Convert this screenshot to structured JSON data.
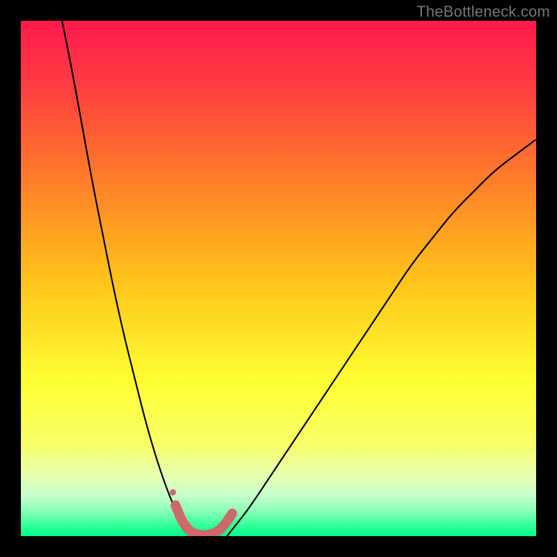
{
  "watermark": "TheBottleneck.com",
  "chart_data": {
    "type": "line",
    "title": "",
    "xlabel": "",
    "ylabel": "",
    "xlim": [
      0,
      100
    ],
    "ylim": [
      0,
      100
    ],
    "grid": false,
    "legend": false,
    "gradient_stops": [
      {
        "offset": 0.0,
        "color": "#ff1a4d"
      },
      {
        "offset": 0.12,
        "color": "#ff3b42"
      },
      {
        "offset": 0.3,
        "color": "#ff7a2a"
      },
      {
        "offset": 0.5,
        "color": "#ffc21a"
      },
      {
        "offset": 0.7,
        "color": "#ffff33"
      },
      {
        "offset": 0.82,
        "color": "#f7ff66"
      },
      {
        "offset": 0.88,
        "color": "#e9ffb0"
      },
      {
        "offset": 0.92,
        "color": "#c8ffcc"
      },
      {
        "offset": 0.95,
        "color": "#8effb8"
      },
      {
        "offset": 0.975,
        "color": "#3eff9e"
      },
      {
        "offset": 1.0,
        "color": "#00ff88"
      }
    ],
    "series": [
      {
        "name": "left-curve",
        "stroke": "#000000",
        "width": 2.2,
        "x": [
          8,
          10,
          12,
          14,
          16,
          18,
          20,
          22,
          24,
          26,
          28,
          30,
          32
        ],
        "y": [
          100,
          90,
          79,
          68,
          58,
          48,
          39,
          31,
          23,
          16,
          10,
          5,
          1
        ]
      },
      {
        "name": "right-curve",
        "stroke": "#000000",
        "width": 2.2,
        "x": [
          40,
          44,
          48,
          52,
          56,
          60,
          64,
          68,
          72,
          76,
          80,
          84,
          88,
          92,
          96,
          100
        ],
        "y": [
          0,
          5,
          11,
          17,
          23,
          29,
          35,
          41,
          47,
          53,
          58,
          63,
          67,
          71,
          74,
          77
        ]
      },
      {
        "name": "valley-thick",
        "stroke": "#cc6a6a",
        "width": 14,
        "linecap": "round",
        "x": [
          30,
          31,
          32,
          33,
          34,
          35,
          36,
          37,
          38,
          39,
          40,
          41
        ],
        "y": [
          6,
          3.5,
          1.8,
          0.8,
          0.4,
          0.2,
          0.2,
          0.4,
          0.8,
          1.6,
          2.8,
          4.4
        ]
      }
    ],
    "markers": [
      {
        "name": "left-dot",
        "x": 29.5,
        "y": 8.5,
        "r": 4.5,
        "color": "#cc6a6a"
      }
    ]
  }
}
